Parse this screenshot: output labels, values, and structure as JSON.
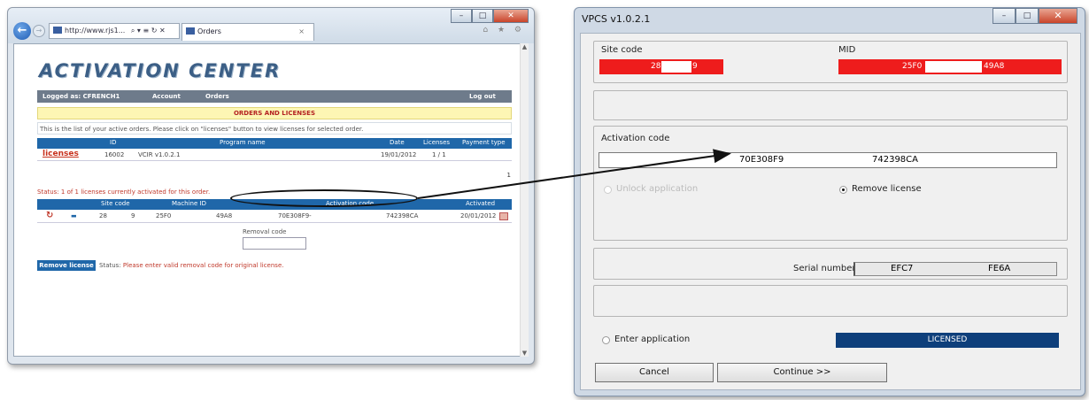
{
  "browser": {
    "address": "http://www.rjs1...",
    "address_icons": "⌕ ▾ ≡ ↻ ✕",
    "tab_title": "Orders",
    "tab_close": "×",
    "nav_icons": "⌂ ★ ⚙",
    "logo": "ACTIVATION CENTER",
    "menu": {
      "logged_as": "Logged as: CFRENCH1",
      "account": "Account",
      "orders": "Orders",
      "logout": "Log out"
    },
    "orders_heading": "ORDERS AND LICENSES",
    "info_text": "This is the list of your active orders. Please click on \"licenses\" button to view licenses for selected order.",
    "orders_table": {
      "headers": [
        "ID",
        "Program name",
        "Date",
        "Licenses",
        "Payment type"
      ],
      "row": {
        "link": "licenses",
        "id": "16002",
        "program": "VCIR v1.0.2.1",
        "date": "19/01/2012",
        "licenses": "1 / 1"
      },
      "pager": "1"
    },
    "status_line": "Status: 1 of 1 licenses currently activated for this order.",
    "licenses_table": {
      "headers": [
        "Site code",
        "Machine ID",
        "Activation code",
        "Activated"
      ],
      "row": {
        "site_code_a": "28",
        "site_code_b": "9",
        "mid_a": "25F0",
        "mid_b": "49A8",
        "act_a": "70E308F9-",
        "act_b": "742398CA",
        "activated": "20/01/2012"
      }
    },
    "removal_label": "Removal code",
    "remove_button": "Remove license",
    "status2_prefix": "Status:",
    "status2_msg": "Please enter valid removal code for original license."
  },
  "vpcs": {
    "title": "VPCS v1.0.2.1",
    "site_code_label": "Site code",
    "site_code_a": "28",
    "site_code_b": "9",
    "mid_label": "MID",
    "mid_a": "25F0",
    "mid_b": "49A8",
    "activation_label": "Activation code",
    "activation_a": "70E308F9",
    "activation_b": "742398CA",
    "unlock_label": "Unlock application",
    "remove_label": "Remove license",
    "serial_label": "Serial number",
    "serial_a": "EFC7",
    "serial_b": "FE6A",
    "enter_label": "Enter application",
    "licensed": "LICENSED",
    "cancel": "Cancel",
    "continue": "Continue >>"
  },
  "colors": {
    "accent_blue": "#1f67a9",
    "red_field": "#ee1c1c",
    "licensed_bg": "#0e3f7b"
  }
}
